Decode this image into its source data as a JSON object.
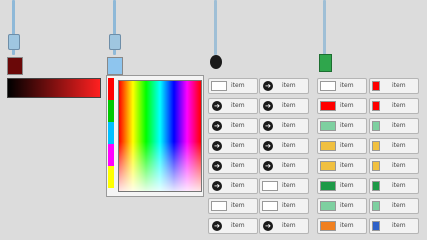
{
  "colors": {
    "background": "#dcdcdc",
    "slider_blue": "#8fb9d8",
    "dark_red": "#6a0808",
    "light_blue": "#8ec5ee",
    "green": "#2fa64c"
  },
  "color_picker": {
    "strip_colors": [
      "#ff0000",
      "#00c800",
      "#00bfff",
      "#ff00ff",
      "#ffff00"
    ]
  },
  "icon_list": {
    "left_items": [
      {
        "icon": "white-chip",
        "label": "item"
      },
      {
        "icon": "circle-arrow-icon",
        "label": "item"
      },
      {
        "icon": "circle-arrow-icon",
        "label": "item"
      },
      {
        "icon": "circle-arrow-icon",
        "label": "item"
      },
      {
        "icon": "circle-arrow-icon",
        "label": "item"
      },
      {
        "icon": "circle-arrow-icon",
        "label": "item"
      },
      {
        "icon": "white-chip",
        "label": "item"
      },
      {
        "icon": "circle-arrow-icon",
        "label": "item"
      },
      {
        "icon": "circle-arrow-icon",
        "label": "item"
      }
    ],
    "right_items": [
      {
        "icon": "circle-arrow-icon",
        "label": "item"
      },
      {
        "icon": "circle-arrow-icon",
        "label": "item"
      },
      {
        "icon": "circle-arrow-icon",
        "label": "item"
      },
      {
        "icon": "circle-arrow-icon",
        "label": "item"
      },
      {
        "icon": "circle-arrow-icon",
        "label": "item"
      },
      {
        "icon": "white-chip",
        "label": "item"
      },
      {
        "icon": "white-chip",
        "label": "item"
      },
      {
        "icon": "circle-arrow-icon",
        "label": "item"
      },
      {
        "icon": "circle-arrow-icon",
        "label": "item"
      }
    ]
  },
  "palette_list": {
    "left_items": [
      {
        "color": "#ffffff",
        "label": "item"
      },
      {
        "color": "#ff0000",
        "label": "item"
      },
      {
        "color": "#7ed0a0",
        "label": "item"
      },
      {
        "color": "#f0c040",
        "label": "item"
      },
      {
        "color": "#f0c040",
        "label": "item"
      },
      {
        "color": "#1e9a48",
        "label": "item"
      },
      {
        "color": "#7ed0a0",
        "label": "item"
      },
      {
        "color": "#f08020",
        "label": "item"
      },
      {
        "color": "#2e60c8",
        "label": "item"
      }
    ],
    "right_items": [
      {
        "color": "#ff0000",
        "label": "item"
      },
      {
        "color": "#ff0000",
        "label": "item"
      },
      {
        "color": "#7ed0a0",
        "label": "item"
      },
      {
        "color": "#f0c040",
        "label": "item"
      },
      {
        "color": "#f0c040",
        "label": "item"
      },
      {
        "color": "#1e9a48",
        "label": "item"
      },
      {
        "color": "#7ed0a0",
        "label": "item"
      },
      {
        "color": "#f08020",
        "label": "item"
      },
      {
        "color": "#2e60c8",
        "label": "item"
      }
    ]
  }
}
